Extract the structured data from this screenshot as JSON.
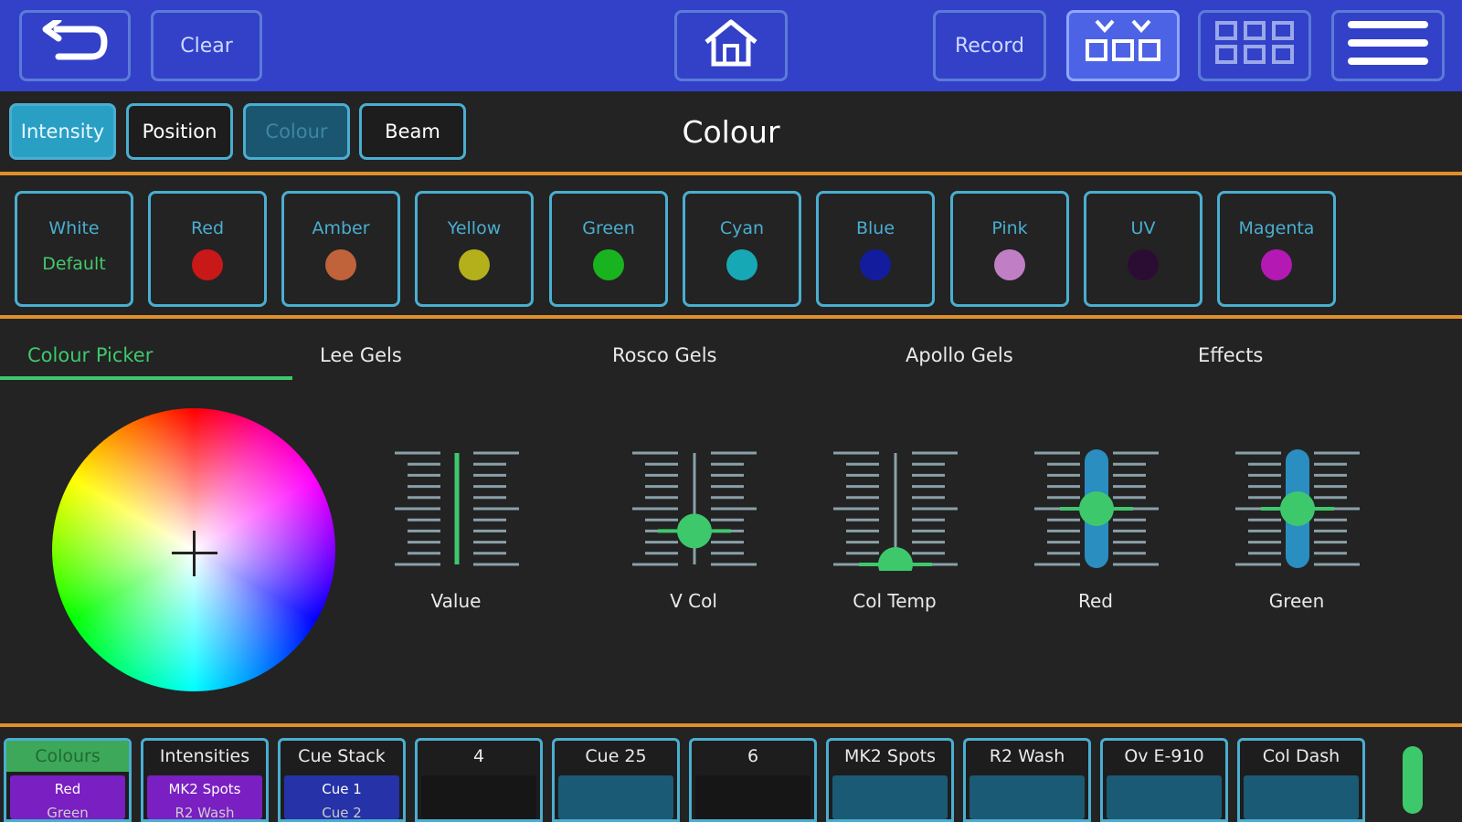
{
  "topbar": {
    "clear_label": "Clear",
    "record_label": "Record"
  },
  "param_tabs": [
    {
      "label": "Intensity",
      "state": "selected"
    },
    {
      "label": "Position",
      "state": "normal"
    },
    {
      "label": "Colour",
      "state": "disabled"
    },
    {
      "label": "Beam",
      "state": "normal"
    }
  ],
  "section_title": "Colour",
  "swatches": [
    {
      "label": "White",
      "sub": "Default",
      "color": null
    },
    {
      "label": "Red",
      "color": "#c81818"
    },
    {
      "label": "Amber",
      "color": "#c0623a"
    },
    {
      "label": "Yellow",
      "color": "#b3b01c"
    },
    {
      "label": "Green",
      "color": "#19b31f"
    },
    {
      "label": "Cyan",
      "color": "#17a8b5"
    },
    {
      "label": "Blue",
      "color": "#141c9e"
    },
    {
      "label": "Pink",
      "color": "#c07ec4"
    },
    {
      "label": "UV",
      "color": "#2b0d33"
    },
    {
      "label": "Magenta",
      "color": "#b419b4"
    }
  ],
  "gel_tabs": [
    {
      "label": "Colour Picker",
      "active": true
    },
    {
      "label": "Lee Gels"
    },
    {
      "label": "Rosco Gels"
    },
    {
      "label": "Apollo Gels"
    },
    {
      "label": "Effects"
    }
  ],
  "faders": [
    {
      "label": "Value",
      "level": 1.0,
      "style": "line"
    },
    {
      "label": "V Col",
      "level": 0.3,
      "style": "knob"
    },
    {
      "label": "Col Temp",
      "level": 0.0,
      "style": "knob"
    },
    {
      "label": "Red",
      "level": 0.5,
      "style": "knob-bar"
    },
    {
      "label": "Green",
      "level": 0.5,
      "style": "knob-bar"
    }
  ],
  "stack_buttons": [
    {
      "head": "Colours",
      "line1": "Red",
      "line2": "Green",
      "fill": "#7a1fc2",
      "head_color": "#3ec86c",
      "head_bg": "#3ea85a"
    },
    {
      "head": "Intensities",
      "line1": "MK2 Spots",
      "line2": "R2 Wash",
      "fill": "#7a1fc2"
    },
    {
      "head": "Cue Stack",
      "line1": "Cue 1",
      "line2": "Cue 2",
      "fill": "#2632a8"
    },
    {
      "head": "4",
      "line1": "",
      "line2": "",
      "fill": "#161616"
    },
    {
      "head": "Cue 25",
      "line1": "",
      "line2": "",
      "fill": "#1b5a74"
    },
    {
      "head": "6",
      "line1": "",
      "line2": "",
      "fill": "#161616"
    },
    {
      "head": "MK2 Spots",
      "line1": "",
      "line2": "",
      "fill": "#1b5a74"
    },
    {
      "head": "R2 Wash",
      "line1": "",
      "line2": "",
      "fill": "#1b5a74"
    },
    {
      "head": "Ov E-910",
      "line1": "",
      "line2": "",
      "fill": "#1b5a74"
    },
    {
      "head": "Col Dash",
      "line1": "",
      "line2": "",
      "fill": "#1b5a74"
    }
  ],
  "icons": [
    "undo-icon",
    "home-icon",
    "fixture-select-icon",
    "grid-icon",
    "menu-icon"
  ]
}
